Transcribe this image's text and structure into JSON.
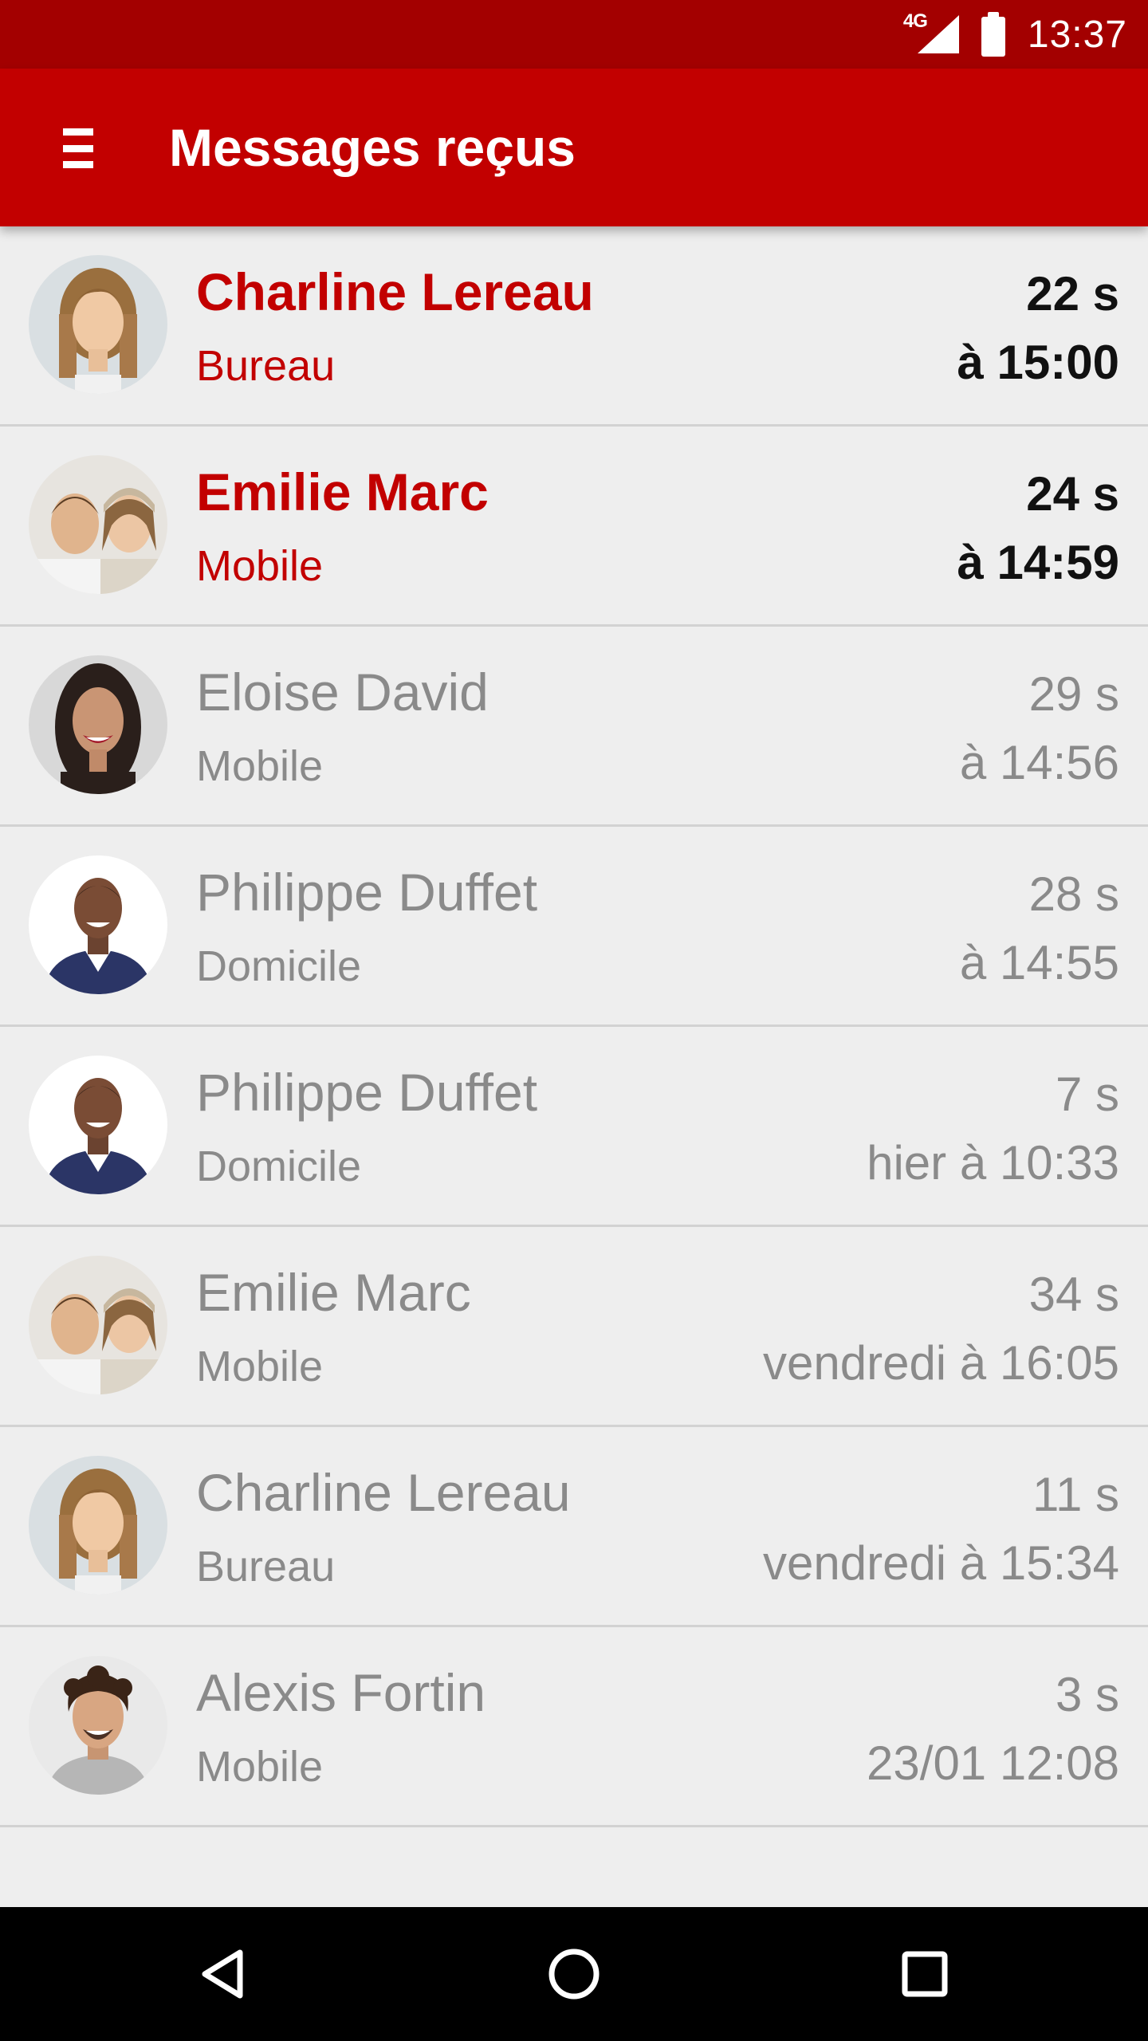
{
  "status_bar": {
    "network": "4G",
    "time": "13:37"
  },
  "app_bar": {
    "title": "Messages reçus",
    "menu_icon": "hamburger-menu-icon"
  },
  "colors": {
    "status_bar": "#a30000",
    "app_bar": "#c20000",
    "unread_name": "#c20000",
    "read_text": "#8a8a8a",
    "background": "#eeeeee"
  },
  "messages": [
    {
      "name": "Charline Lereau",
      "type": "Bureau",
      "duration": "22 s",
      "when": "à 15:00",
      "unread": true
    },
    {
      "name": "Emilie Marc",
      "type": "Mobile",
      "duration": "24 s",
      "when": "à 14:59",
      "unread": true
    },
    {
      "name": "Eloise David",
      "type": "Mobile",
      "duration": "29 s",
      "when": "à 14:56",
      "unread": false
    },
    {
      "name": "Philippe Duffet",
      "type": "Domicile",
      "duration": "28 s",
      "when": "à 14:55",
      "unread": false
    },
    {
      "name": "Philippe Duffet",
      "type": "Domicile",
      "duration": "7 s",
      "when": "hier à 10:33",
      "unread": false
    },
    {
      "name": "Emilie Marc",
      "type": "Mobile",
      "duration": "34 s",
      "when": "vendredi à 16:05",
      "unread": false
    },
    {
      "name": "Charline Lereau",
      "type": "Bureau",
      "duration": "11 s",
      "when": "vendredi à 15:34",
      "unread": false
    },
    {
      "name": "Alexis Fortin",
      "type": "Mobile",
      "duration": "3 s",
      "when": "23/01 12:08",
      "unread": false
    }
  ],
  "nav_bar": {
    "back_icon": "back-triangle-icon",
    "home_icon": "home-circle-icon",
    "recents_icon": "recents-square-icon"
  }
}
